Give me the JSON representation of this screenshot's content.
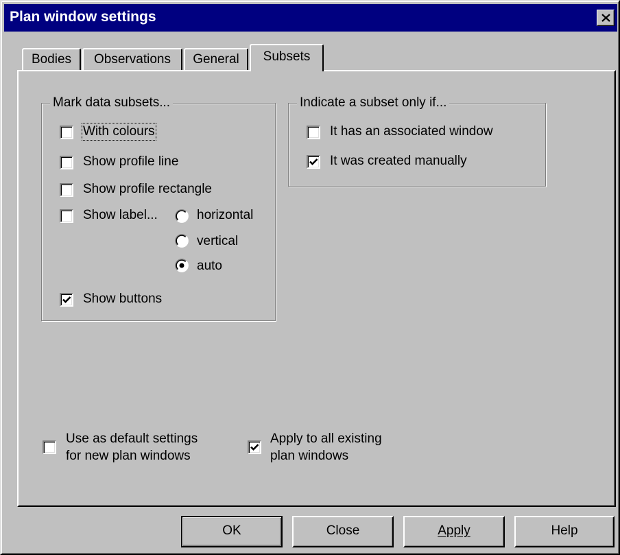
{
  "window": {
    "title": "Plan window settings"
  },
  "tabs": [
    {
      "label": "Bodies"
    },
    {
      "label": "Observations"
    },
    {
      "label": "General"
    },
    {
      "label": "Subsets"
    }
  ],
  "mark_group": {
    "label": "Mark data subsets...",
    "with_colours": "With colours",
    "show_profile_line": "Show profile line",
    "show_profile_rectangle": "Show profile rectangle",
    "show_label": "Show label...",
    "radio_horizontal": "horizontal",
    "radio_vertical": "vertical",
    "radio_auto": "auto",
    "show_buttons": "Show buttons"
  },
  "indicate_group": {
    "label": "Indicate a subset only if...",
    "associated_window": "It has an associated window",
    "created_manually": "It was created manually"
  },
  "defaults": {
    "line1": "Use as default settings",
    "line2": "for new plan windows"
  },
  "apply_all": {
    "line1": "Apply to all existing",
    "line2": "plan windows"
  },
  "buttons": {
    "ok": "OK",
    "close": "Close",
    "apply": "Apply",
    "help": "Help"
  },
  "state": {
    "with_colours": false,
    "show_profile_line": false,
    "show_profile_rectangle": false,
    "show_label": false,
    "label_orientation": "auto",
    "show_buttons": true,
    "associated_window": false,
    "created_manually": true,
    "use_as_default": false,
    "apply_to_all": true
  },
  "colors": {
    "titlebar": "#000080",
    "face": "#c0c0c0"
  }
}
